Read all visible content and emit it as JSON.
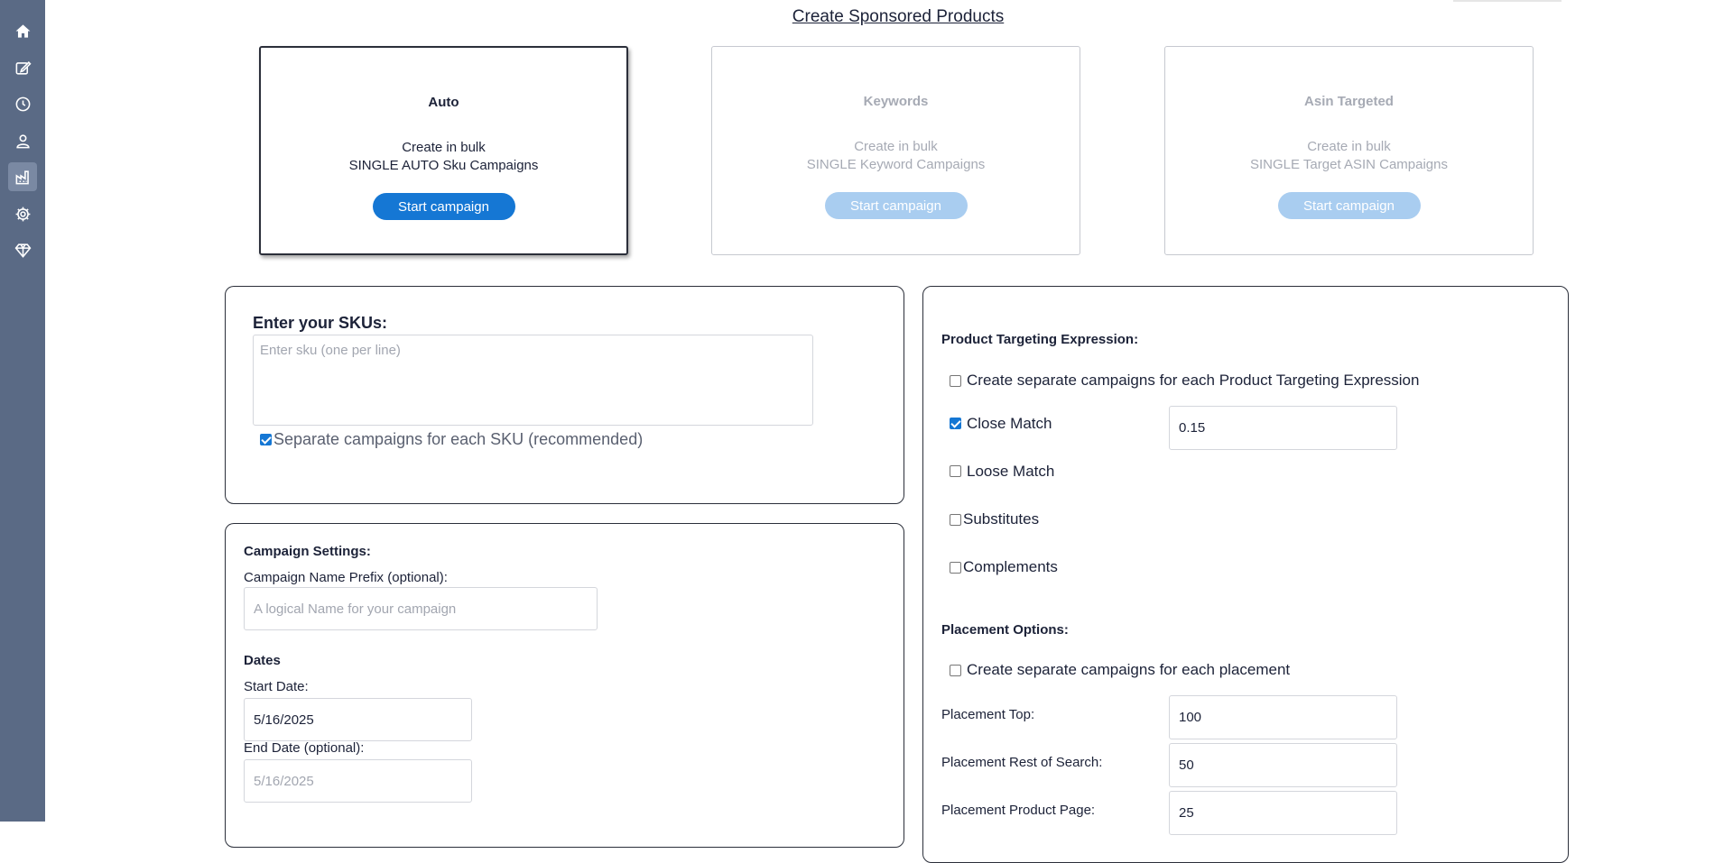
{
  "page": {
    "title": "Create Sponsored Products"
  },
  "sidebar": {
    "items": [
      {
        "icon": "home-icon"
      },
      {
        "icon": "edit-icon"
      },
      {
        "icon": "clock-icon"
      },
      {
        "icon": "user-icon"
      },
      {
        "icon": "factory-icon",
        "active": true
      },
      {
        "icon": "gear-icon"
      },
      {
        "icon": "diamond-icon"
      }
    ]
  },
  "cards": [
    {
      "title": "Auto",
      "line1": "Create in bulk",
      "line2": "SINGLE AUTO Sku Campaigns",
      "button": "Start campaign",
      "state": "selected"
    },
    {
      "title": "Keywords",
      "line1": "Create in bulk",
      "line2": "SINGLE Keyword Campaigns",
      "button": "Start campaign",
      "state": "disabled"
    },
    {
      "title": "Asin Targeted",
      "line1": "Create in bulk",
      "line2": "SINGLE Target ASIN Campaigns",
      "button": "Start campaign",
      "state": "disabled"
    }
  ],
  "skus": {
    "heading": "Enter your SKUs:",
    "placeholder": "Enter sku (one per line)",
    "separate_label": "Separate campaigns for each SKU (recommended)",
    "separate_checked": true
  },
  "campaign_settings": {
    "heading": "Campaign Settings:",
    "name_prefix_label": "Campaign Name Prefix (optional):",
    "name_prefix_placeholder": "A logical Name for your campaign",
    "dates_heading": "Dates",
    "start_date_label": "Start Date:",
    "start_date_value": "5/16/2025",
    "end_date_label": "End Date (optional):",
    "end_date_placeholder": "5/16/2025"
  },
  "targeting": {
    "heading": "Product Targeting Expression:",
    "separate_label": "Create separate campaigns for each Product Targeting Expression",
    "separate_checked": false,
    "close_match_label": "Close Match",
    "close_match_checked": true,
    "close_match_bid": "0.15",
    "loose_match_label": "Loose Match",
    "loose_match_checked": false,
    "substitutes_label": "Substitutes",
    "substitutes_checked": false,
    "complements_label": "Complements",
    "complements_checked": false
  },
  "placement": {
    "heading": "Placement Options:",
    "separate_label": "Create separate campaigns for each placement",
    "separate_checked": false,
    "top_label": "Placement Top:",
    "top_value": "100",
    "rest_label": "Placement Rest of Search:",
    "rest_value": "50",
    "product_label": "Placement Product Page:",
    "product_value": "25"
  },
  "colors": {
    "sidebar": "#5a6a85",
    "primary": "#1577d4",
    "primary_disabled": "#a9cdf0",
    "text": "#1c2238"
  }
}
